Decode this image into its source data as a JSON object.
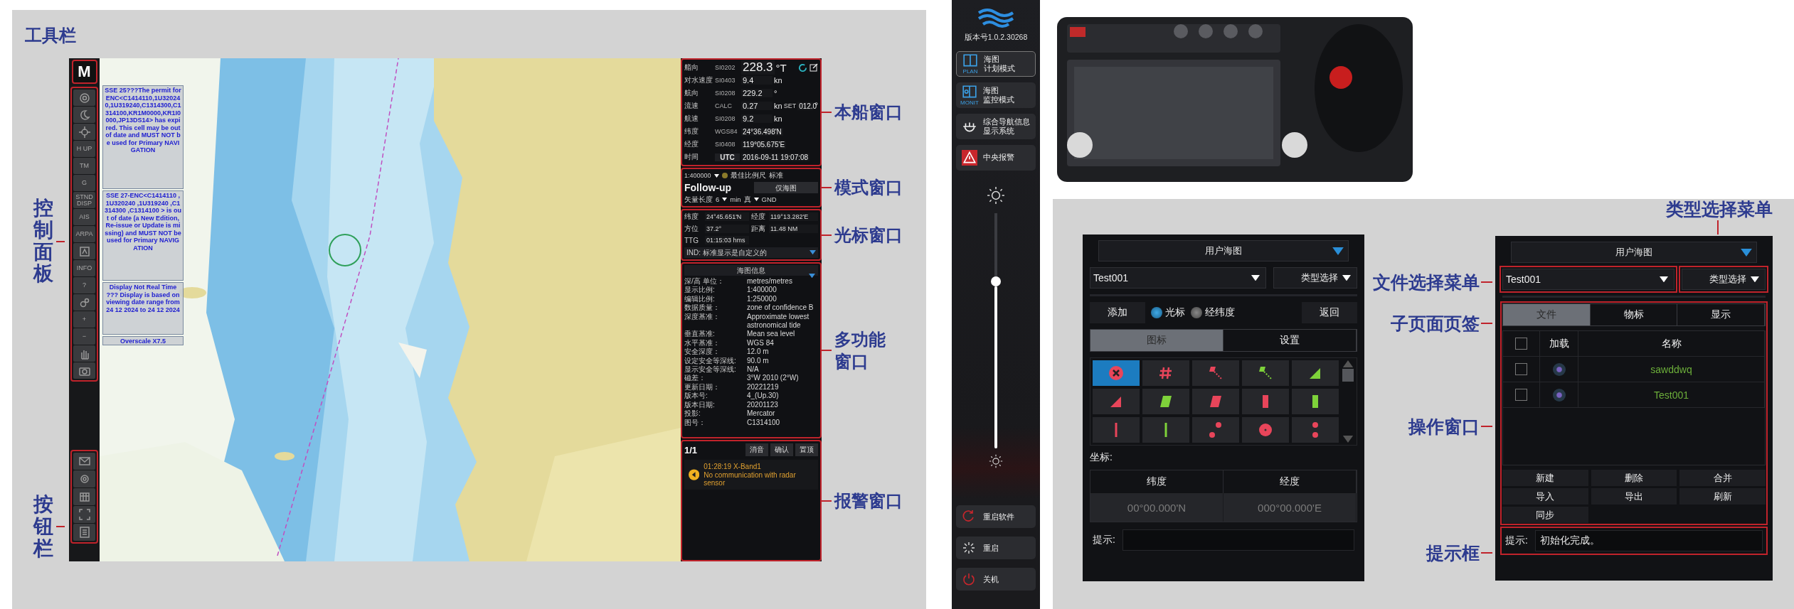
{
  "ecdis": {
    "annotations_left": {
      "toolbar": "工具栏",
      "control_panel": "控制面板",
      "button_bar": "按钮栏"
    },
    "toolbar": {
      "top": "M",
      "tools": [
        {
          "kind": "lifebuoy"
        },
        {
          "kind": "moon"
        },
        {
          "kind": "crosshair"
        },
        {
          "kind": "text",
          "label": "H UP"
        },
        {
          "kind": "text",
          "label": "TM"
        },
        {
          "kind": "text",
          "label": "G"
        },
        {
          "kind": "text",
          "label": "STND DISP"
        },
        {
          "kind": "text",
          "label": "AIS"
        },
        {
          "kind": "text",
          "label": "ARPA"
        },
        {
          "kind": "map"
        },
        {
          "kind": "text",
          "label": "INFO"
        },
        {
          "kind": "text",
          "label": "?"
        },
        {
          "kind": "gears"
        },
        {
          "kind": "text",
          "label": "+"
        },
        {
          "kind": "text",
          "label": "−"
        },
        {
          "kind": "hand"
        },
        {
          "kind": "camera"
        }
      ]
    },
    "chart_view": {
      "kind": "picture"
    },
    "chart_notes": [
      "SSE 25???The permit for ENC<C1414110,1U320240,1U319240,C1314300,C1314100,KR1M0000,KR1I0000,JP13DS14> has expired. This cell may be out of date and MUST NOT be used for Primary NAVIGATION",
      "SSE 27-ENC<C1414110 ,1U320240 ,1U319240 ,C1314300 ,C1314100 > is out of date (a New Edition, Re-issue or Update is missing) and MUST NOT be used for Primary NAVIGATION",
      "Display Not Real Time ??? Display is based on viewing date range from 24 12 2024 to 24 12 2024",
      "Overscale X7.5"
    ],
    "own_ship": [
      {
        "label": "艏向",
        "source": "SI0202",
        "value": "228.3",
        "unit": "°T"
      },
      {
        "label": "对水速度",
        "source": "SI0403",
        "value": "9.4",
        "unit": "kn"
      },
      {
        "label": "航向",
        "source": "SI0208",
        "value": "229.2",
        "unit": "°"
      },
      {
        "label": "流速",
        "source": "CALC",
        "value": "0.27",
        "unit": "kn",
        "set_label": "SET",
        "set_value": "012.0",
        "set_unit": "°"
      },
      {
        "label": "航速",
        "source": "SI0208",
        "value": "9.2",
        "unit": "kn"
      },
      {
        "label": "纬度",
        "source": "WGS84",
        "value": "24°36.498'N"
      },
      {
        "label": "经度",
        "source": "SI0408",
        "value": "119°05.675'E"
      },
      {
        "label": "时间",
        "source": "UTC",
        "value": "2016-09-11 19:07:08"
      }
    ],
    "mode": {
      "scale": "1:400000",
      "best_scale": "最佳比例尺",
      "display": "标准",
      "follow": "Follow-up",
      "chart_only": "仅海图",
      "vector_label": "矢量长度",
      "vector_value": "6",
      "vector_unit": "min",
      "vector_mode": "真",
      "ground": "GND"
    },
    "cursor": {
      "pairs": [
        {
          "label": "纬度",
          "value": "24°45.651'N"
        },
        {
          "label": "经度",
          "value": "119°13.282'E"
        },
        {
          "label": "方位",
          "value": "37.2°"
        },
        {
          "label": "距离",
          "value": "11.48 NM"
        },
        {
          "label": "TTG",
          "value": "01:15:03 hms"
        }
      ],
      "ind": "IND: 标准显示是自定义的"
    },
    "chart_info": {
      "title": "海图信息",
      "rows": [
        {
          "label": "深/高 单位：",
          "value": "metres/metres"
        },
        {
          "label": "显示比例:",
          "value": "1:400000"
        },
        {
          "label": "编辑比例:",
          "value": "1:250000"
        },
        {
          "label": "数据质量：",
          "value": "zone of confidence B"
        },
        {
          "label": "深度基准：",
          "value": "Approximate lowest astronomical tide"
        },
        {
          "label": "垂直基准:",
          "value": "Mean sea level"
        },
        {
          "label": "水平基准：",
          "value": "WGS 84"
        },
        {
          "label": "安全深度：",
          "value": "12.0 m"
        },
        {
          "label": "设定安全等深线:",
          "value": "90.0 m"
        },
        {
          "label": "显示安全等深线:",
          "value": "N/A"
        },
        {
          "label": "磁差：",
          "value": "3°W 2010 (2°W)"
        },
        {
          "label": "更新日期：",
          "value": "20221219"
        },
        {
          "label": "版本号:",
          "value": "4_(Up.30)"
        },
        {
          "label": "版本日期:",
          "value": "20201123"
        },
        {
          "label": "投影:",
          "value": "Mercator"
        },
        {
          "label": "图号：",
          "value": "C1314100"
        }
      ]
    },
    "alarms": {
      "count": "1/1",
      "buttons": [
        "消音",
        "确认",
        "置顶"
      ],
      "items": [
        {
          "time": "01:28:19 X-Band1",
          "message": "No communication with radar sensor"
        }
      ]
    },
    "annotations_right": [
      "本船窗口",
      "模式窗口",
      "光标窗口",
      "多功能窗口",
      "报警窗口"
    ]
  },
  "sidebar": {
    "version": "版本号1.0.2.30268",
    "modes": [
      {
        "kind": "plan",
        "badge": "PLAN",
        "lines": [
          "海图",
          "计划模式"
        ]
      },
      {
        "kind": "monit",
        "badge": "MONIT",
        "lines": [
          "海图",
          "监控模式"
        ]
      },
      {
        "kind": "helm",
        "lines": [
          "综合导航信息",
          "显示系统"
        ]
      },
      {
        "kind": "alarm",
        "lines": [
          "中央报警"
        ]
      }
    ],
    "brightness": {
      "level": 0.71
    },
    "power": [
      {
        "kind": "restart-app",
        "label": "重启软件"
      },
      {
        "kind": "reboot",
        "label": "重启"
      },
      {
        "kind": "power",
        "label": "关机"
      }
    ]
  },
  "keyboard": {
    "kind": "picture"
  },
  "chart_tool_left": {
    "header": "用户海图",
    "file": "Test001",
    "type_menu": "类型选择",
    "add": "添加",
    "radios": [
      {
        "label": "光标",
        "selected": true
      },
      {
        "label": "经纬度",
        "selected": false
      }
    ],
    "back": "返回",
    "tabs": [
      {
        "label": "图标",
        "selected": true
      },
      {
        "label": "设置",
        "selected": false
      }
    ],
    "symbols": [
      {
        "kind": "cross-circle",
        "color": "#e8455a",
        "selected": true
      },
      {
        "kind": "hash",
        "color": "#e8455a",
        "selected": false
      },
      {
        "kind": "flag-dashed",
        "color": "#e8455a",
        "selected": false
      },
      {
        "kind": "flag-dashed",
        "color": "#7ed23a",
        "selected": false
      },
      {
        "kind": "triangle",
        "color": "#7ed23a",
        "selected": false
      },
      {
        "kind": "triangle",
        "color": "#e8455a",
        "selected": false
      },
      {
        "kind": "parallelogram",
        "color": "#7ed23a",
        "selected": false
      },
      {
        "kind": "parallelogram",
        "color": "#e8455a",
        "selected": false
      },
      {
        "kind": "rect",
        "color": "#e8455a",
        "selected": false
      },
      {
        "kind": "rect",
        "color": "#7ed23a",
        "selected": false
      },
      {
        "kind": "bar",
        "color": "#e8455a",
        "selected": false
      },
      {
        "kind": "bar",
        "color": "#7ed23a",
        "selected": false
      },
      {
        "kind": "dots-diagonal",
        "color": "#e8455a",
        "selected": false
      },
      {
        "kind": "ring",
        "color": "#e8455a",
        "selected": false
      },
      {
        "kind": "dots-vertical",
        "color": "#e8455a",
        "selected": false
      }
    ],
    "coord_label": "坐标:",
    "coord_columns": [
      "纬度",
      "经度"
    ],
    "coord_values": [
      "00°00.000'N",
      "000°00.000'E"
    ],
    "prompt_label": "提示:"
  },
  "chart_tool_right": {
    "header": "用户海图",
    "file": "Test001",
    "type_menu": "类型选择",
    "tabs": [
      {
        "label": "文件",
        "selected": true
      },
      {
        "label": "物标",
        "selected": false
      },
      {
        "label": "显示",
        "selected": false
      }
    ],
    "columns": [
      "加载",
      "名称"
    ],
    "header_checked": false,
    "rows": [
      {
        "checked": false,
        "loaded": true,
        "name": "sawddwq"
      },
      {
        "checked": false,
        "loaded": true,
        "name": "Test001"
      }
    ],
    "buttons": [
      "新建",
      "删除",
      "合并",
      "导入",
      "导出",
      "刷新",
      "同步"
    ],
    "prompt_label": "提示:",
    "prompt": "初始化完成。"
  },
  "annotations_tool": {
    "type_menu": "类型选择菜单",
    "file_menu": "文件选择菜单",
    "subpage_tabs": "子页面页签",
    "operation": "操作窗口",
    "prompt": "提示框"
  }
}
